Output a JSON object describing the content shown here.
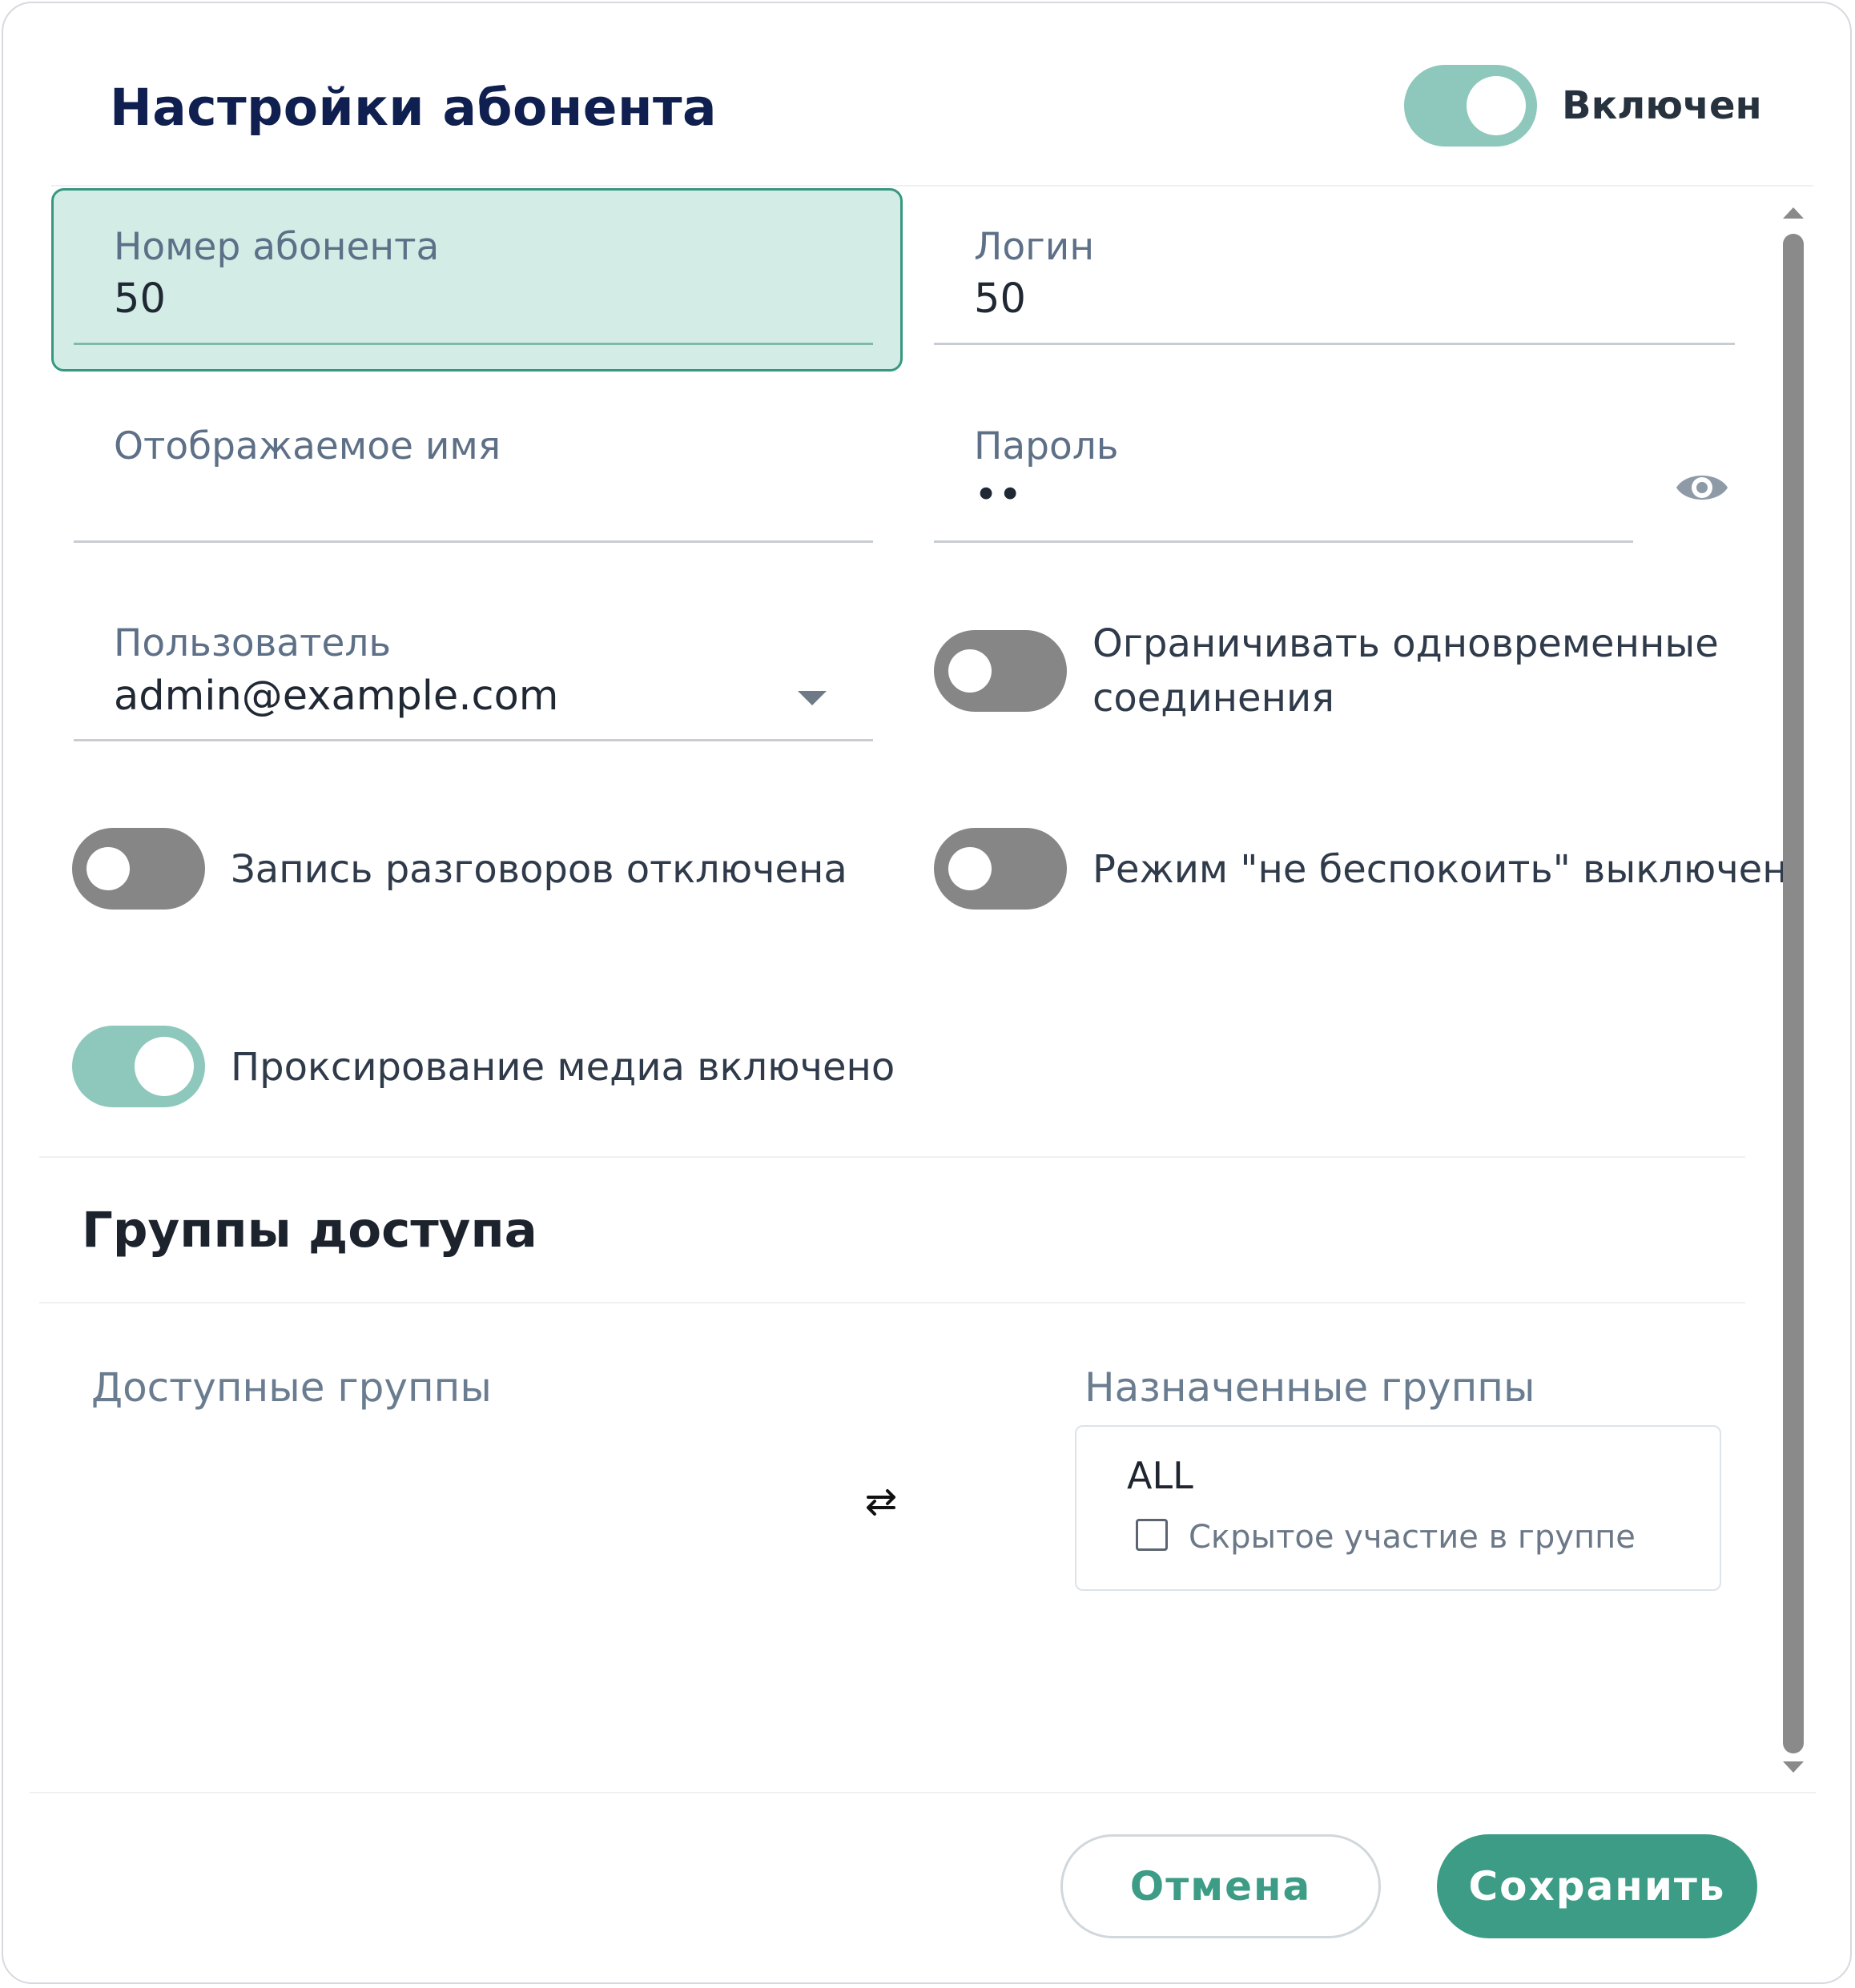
{
  "header": {
    "title": "Настройки абонента",
    "enabled_label": "Включен",
    "enabled": true
  },
  "fields": {
    "number": {
      "label": "Номер абонента",
      "value": "50"
    },
    "login": {
      "label": "Логин",
      "value": "50"
    },
    "display_name": {
      "label": "Отображаемое имя",
      "value": ""
    },
    "password": {
      "label": "Пароль",
      "value": "••"
    },
    "user": {
      "label": "Пользователь",
      "value": "admin@example.com"
    }
  },
  "toggles": {
    "limit_connections": {
      "label_line1": "Ограничивать одновременные",
      "label_line2": "соединения",
      "on": false
    },
    "call_recording": {
      "label": "Запись разговоров отключена",
      "on": false
    },
    "dnd": {
      "label": "Режим \"не беспокоить\" выключен",
      "on": false
    },
    "media_proxy": {
      "label": "Проксирование медиа включено",
      "on": true
    }
  },
  "groups": {
    "title": "Группы доступа",
    "available_label": "Доступные группы",
    "assigned_label": "Назначенные группы",
    "assigned": [
      {
        "name": "ALL",
        "hidden_label": "Скрытое участие в группе",
        "hidden": false
      }
    ]
  },
  "footer": {
    "cancel_label": "Отмена",
    "save_label": "Сохранить"
  },
  "colors": {
    "accent": "#3d9c85",
    "switch_on": "#8ec7bb",
    "switch_off": "#868686",
    "active_field_bg": "#d3ede6"
  }
}
